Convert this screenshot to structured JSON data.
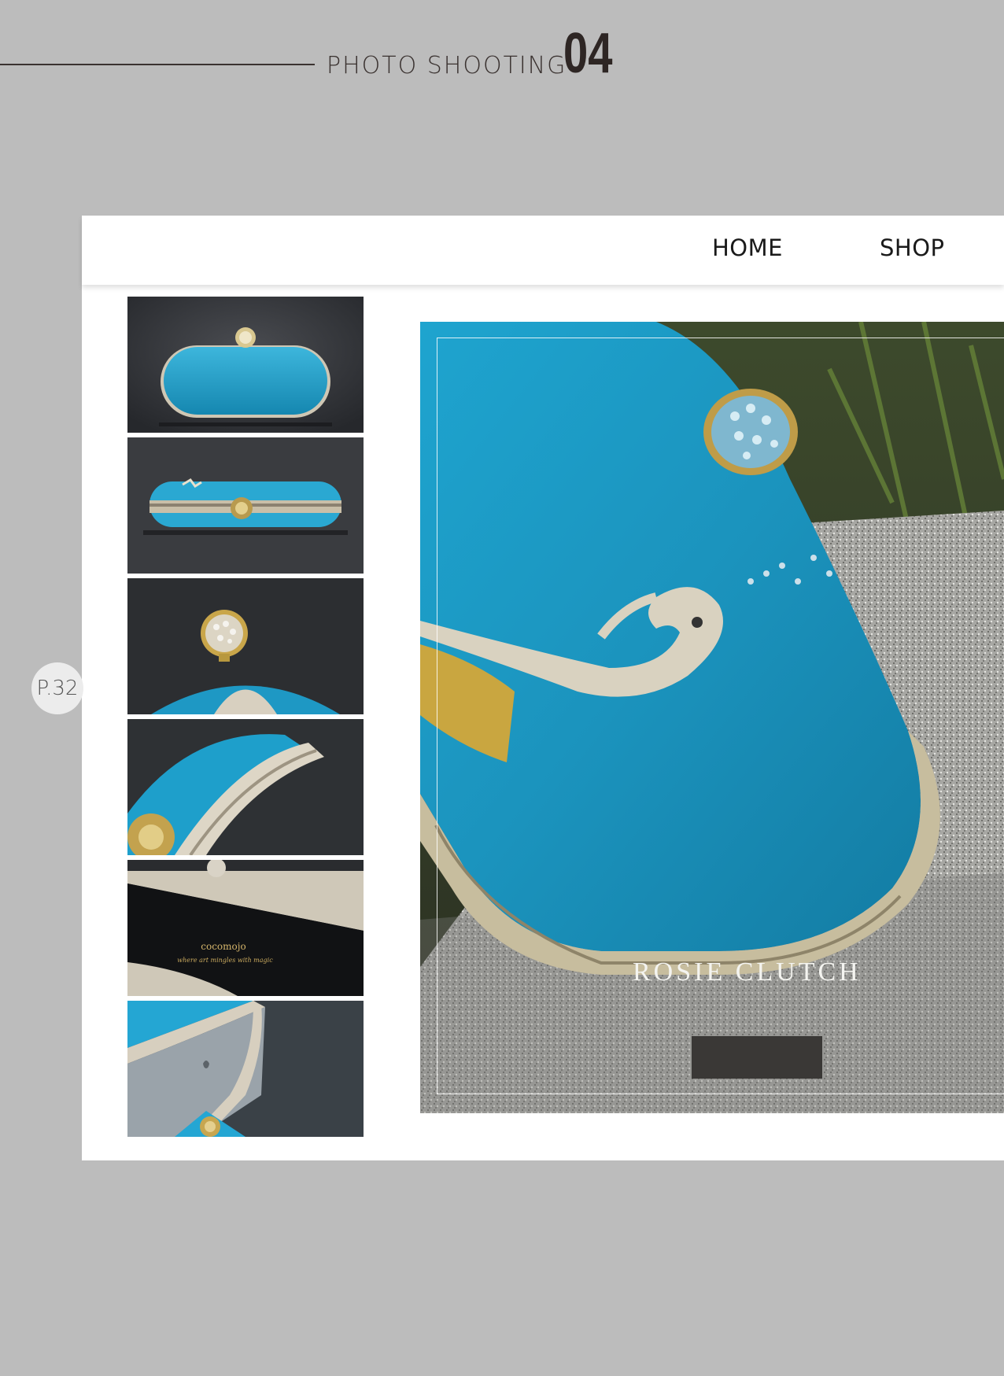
{
  "header": {
    "title": "PHOTO SHOOTING",
    "number": "04"
  },
  "page_badge": "P.32",
  "site": {
    "nav": {
      "home": "HOME",
      "shop": "SHOP"
    },
    "hero": {
      "title": "ROSIE CLUTCH",
      "button_label": ""
    },
    "thumbnails": [
      {
        "name": "clutch-front-view"
      },
      {
        "name": "clutch-side-view"
      },
      {
        "name": "clasp-closeup"
      },
      {
        "name": "frame-closeup"
      },
      {
        "name": "interior-lining",
        "brand": "cocomojo",
        "tagline": "where art mingles with magic"
      },
      {
        "name": "phone-inside"
      }
    ]
  },
  "colors": {
    "bag_blue": "#1f9ec6",
    "background": "#bcbcbc",
    "dark": "#3a3836"
  }
}
